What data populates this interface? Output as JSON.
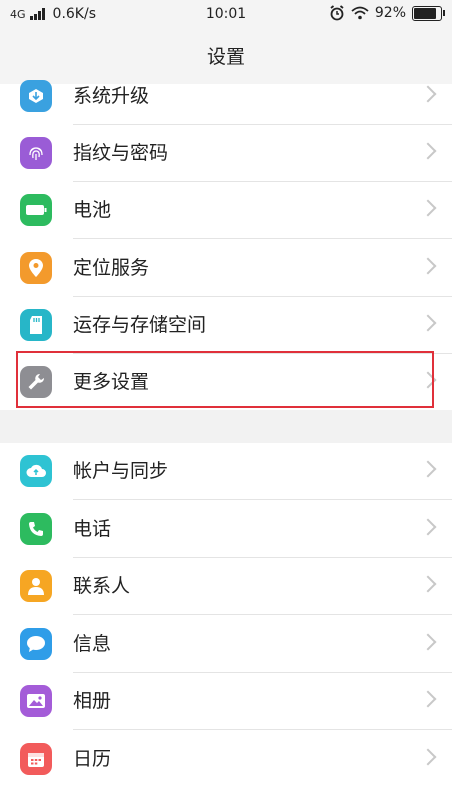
{
  "status": {
    "network": "4G",
    "speed": "0.6K/s",
    "time": "10:01",
    "battery": "92%",
    "battery_level": 0.92
  },
  "header": {
    "title": "设置"
  },
  "section1": {
    "items": [
      {
        "label": "系统升级",
        "icon": "system-update-icon",
        "color": "#3aa1e0"
      },
      {
        "label": "指纹与密码",
        "icon": "fingerprint-icon",
        "color": "#9a5cd6"
      },
      {
        "label": "电池",
        "icon": "battery-icon",
        "color": "#2dbb5f"
      },
      {
        "label": "定位服务",
        "icon": "location-pin-icon",
        "color": "#f39a2c"
      },
      {
        "label": "运存与存储空间",
        "icon": "sd-card-icon",
        "color": "#27b6c8"
      },
      {
        "label": "更多设置",
        "icon": "wrench-icon",
        "color": "#8e8e93"
      }
    ]
  },
  "section2": {
    "items": [
      {
        "label": "帐户与同步",
        "icon": "cloud-sync-icon",
        "color": "#2ec3d3"
      },
      {
        "label": "电话",
        "icon": "phone-icon",
        "color": "#2dbb5f"
      },
      {
        "label": "联系人",
        "icon": "contact-person-icon",
        "color": "#f6a623"
      },
      {
        "label": "信息",
        "icon": "message-bubble-icon",
        "color": "#2f9de8"
      },
      {
        "label": "相册",
        "icon": "photo-album-icon",
        "color": "#a45cd8"
      },
      {
        "label": "日历",
        "icon": "calendar-icon",
        "color": "#f25b5b"
      }
    ]
  }
}
